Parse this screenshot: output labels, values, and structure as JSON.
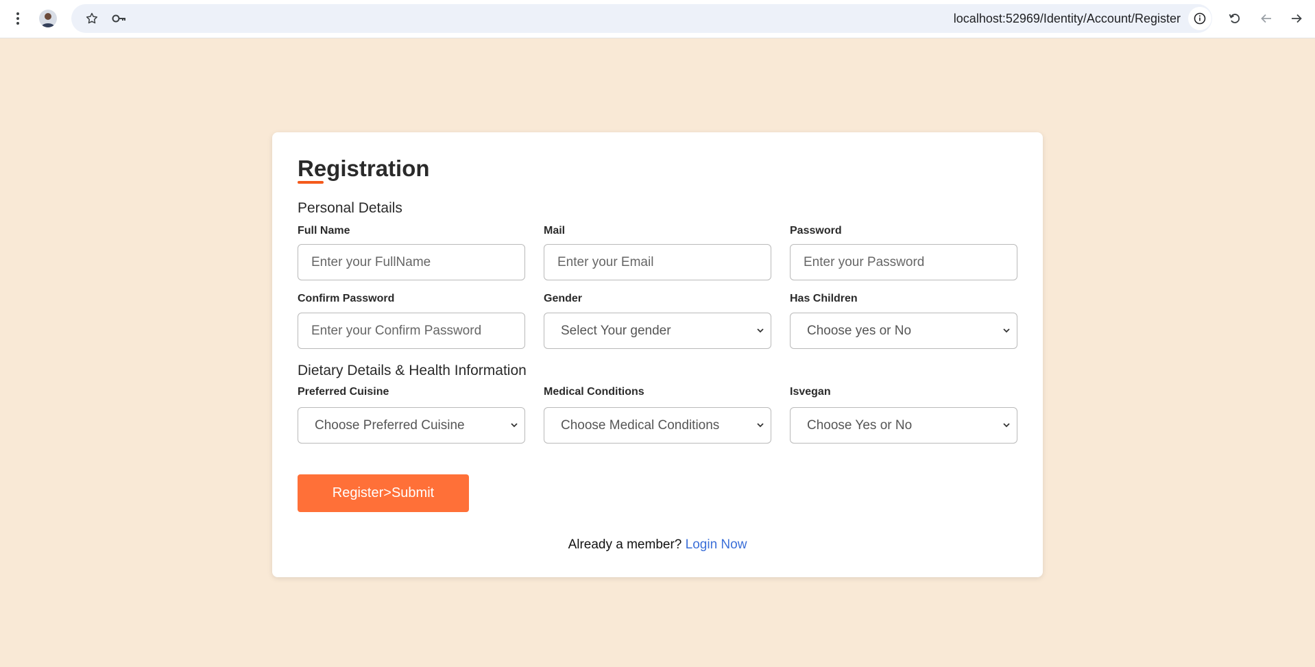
{
  "browser": {
    "url": "localhost:52969/Identity/Account/Register",
    "icons": [
      "kebab-menu-icon",
      "profile-avatar",
      "bookmark-star-icon",
      "password-key-icon",
      "site-info-icon",
      "reload-icon",
      "back-arrow-icon",
      "forward-arrow-icon"
    ]
  },
  "form": {
    "title": "Registration",
    "personal_section": "Personal Details",
    "dietary_section": "Dietary Details & Health Information",
    "fields": {
      "full_name": {
        "label": "Full Name",
        "placeholder": "Enter your FullName"
      },
      "mail": {
        "label": "Mail",
        "placeholder": "Enter your Email"
      },
      "password": {
        "label": "Password",
        "placeholder": "Enter your Password"
      },
      "confirm_password": {
        "label": "Confirm Password",
        "placeholder": "Enter your Confirm Password"
      },
      "gender": {
        "label": "Gender",
        "value": "Select Your gender"
      },
      "has_children": {
        "label": "Has Children",
        "value": "Choose yes or No"
      },
      "preferred_cuisine": {
        "label": "Preferred Cuisine",
        "value": "Choose Preferred Cuisine"
      },
      "medical_conditions": {
        "label": "Medical Conditions",
        "value": "Choose Medical Conditions"
      },
      "isvegan": {
        "label": "Isvegan",
        "value": "Choose Yes or No"
      }
    },
    "submit_label": "Register>Submit",
    "login_prompt": "Already a member?",
    "login_link": "Login Now"
  },
  "colors": {
    "page_background": "#f9e9d6",
    "accent": "#ff7038",
    "link": "#3b6fd8"
  }
}
